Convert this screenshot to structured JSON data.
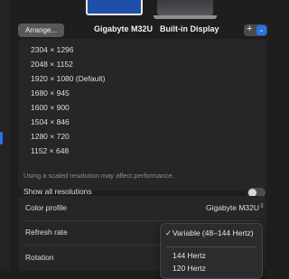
{
  "displays": {
    "arrange_label": "Arrange...",
    "tabs": [
      "Gigabyte M32U",
      "Built-in Display"
    ],
    "add_label": "+",
    "add_menu_icon": "chevron-down-icon"
  },
  "resolutions": {
    "items": [
      "2304 × 1296",
      "2048 × 1152",
      "1920 × 1080 (Default)",
      "1680 × 945",
      "1600 × 900",
      "1504 × 846",
      "1280 × 720",
      "1152 × 648"
    ],
    "show_all_label": "Show all resolutions",
    "show_all_enabled": false,
    "hint": "Using a scaled resolution may affect performance."
  },
  "settings": {
    "color_profile_label": "Color profile",
    "color_profile_value": "Gigabyte M32U",
    "refresh_rate_label": "Refresh rate",
    "rotation_label": "Rotation"
  },
  "refresh_menu": {
    "selected": "Variable (48–144 Hertz)",
    "check_icon": "✓",
    "options": [
      "144 Hertz",
      "120 Hertz"
    ]
  },
  "colors": {
    "accent": "#2a73e8",
    "background": "#1e1e1e",
    "panel": "#262628"
  }
}
